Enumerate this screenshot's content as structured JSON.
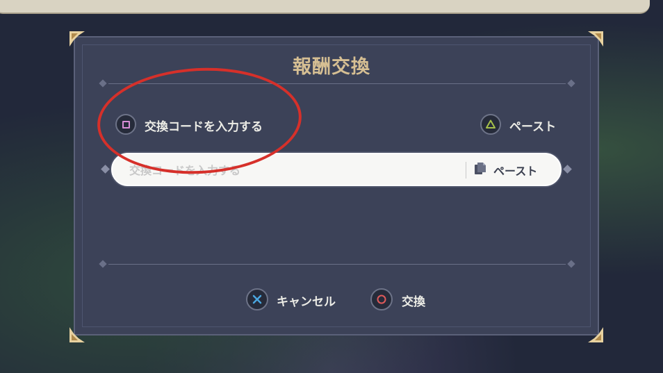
{
  "dialog": {
    "title": "報酬交換"
  },
  "controls": {
    "enter_code_label": "交換コードを入力する",
    "enter_code_button_icon": "square-button-icon",
    "paste_top_label": "ペースト",
    "paste_top_button_icon": "triangle-button-icon"
  },
  "input": {
    "placeholder": "交換コードを入力する",
    "value": "",
    "paste_label": "ペースト",
    "paste_icon": "clipboard-icon"
  },
  "footer": {
    "cancel_label": "キャンセル",
    "cancel_icon": "cross-button-icon",
    "exchange_label": "交換",
    "exchange_icon": "circle-button-icon"
  },
  "colors": {
    "panel": "#3c4258",
    "title": "#d6bf93",
    "square": "#d98ed8",
    "triangle": "#a6c04a",
    "cross": "#4aa6df",
    "circle": "#e15a5a",
    "annotation": "#d6302a"
  }
}
